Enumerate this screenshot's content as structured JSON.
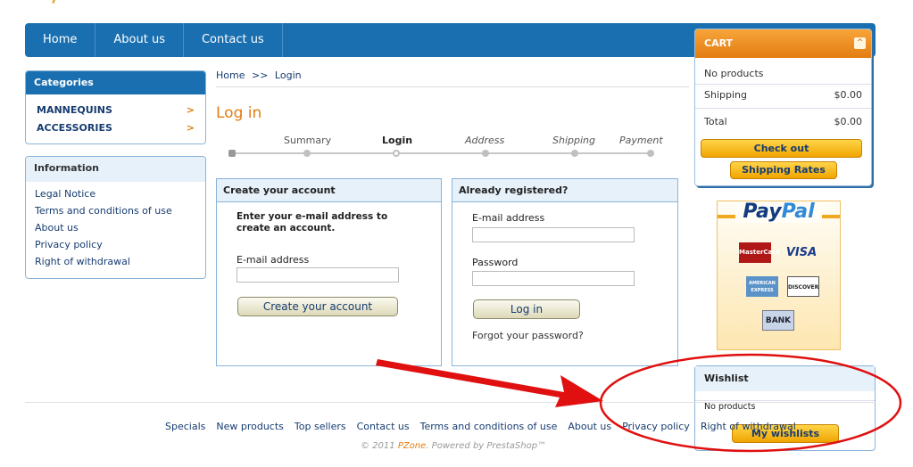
{
  "top_nav": {
    "items": [
      "Home",
      "About us",
      "Contact us"
    ]
  },
  "cart": {
    "title": "CART",
    "toggle_icon": "^",
    "status": "No products",
    "shipping_label": "Shipping",
    "shipping_value": "$0.00",
    "total_label": "Total",
    "total_value": "$0.00",
    "checkout_label": "Check out",
    "shipping_rates_label": "Shipping Rates"
  },
  "categories": {
    "title": "Categories",
    "items": [
      "MANNEQUINS",
      "ACCESSORIES"
    ],
    "chevron": ">"
  },
  "information": {
    "title": "Information",
    "links": [
      "Legal Notice",
      "Terms and conditions of use",
      "About us",
      "Privacy policy",
      "Right of withdrawal"
    ]
  },
  "breadcrumb": {
    "home": "Home",
    "sep": ">>",
    "current": "Login"
  },
  "page_title": "Log in",
  "steps": [
    "Summary",
    "Login",
    "Address",
    "Shipping",
    "Payment"
  ],
  "create_account": {
    "title": "Create your account",
    "instructions": "Enter your e-mail address to create an account.",
    "email_label": "E-mail address",
    "email_value": "",
    "button": "Create your account"
  },
  "registered": {
    "title": "Already registered?",
    "email_label": "E-mail address",
    "email_value": "",
    "password_label": "Password",
    "password_value": "",
    "button": "Log in",
    "forgot": "Forgot your password?"
  },
  "paypal": {
    "brand_pay": "Pay",
    "brand_pal": "Pal",
    "cards": [
      "MasterCard",
      "VISA",
      "AMERICAN EXPRESS",
      "DISCOVER",
      "BANK"
    ]
  },
  "wishlist": {
    "title": "Wishlist",
    "status": "No products",
    "button": "My wishlists"
  },
  "footer": {
    "links": [
      "Specials",
      "New products",
      "Top sellers",
      "Contact us",
      "Terms and conditions of use",
      "About us",
      "Privacy policy",
      "Right of withdrawal"
    ],
    "copyright_prefix": "© 2011 ",
    "copyright_brand": "PZone",
    "copyright_suffix": ". Powered by PrestaShop™"
  },
  "colors": {
    "nav_blue": "#1a6fb0",
    "accent_orange": "#e37d12",
    "annotation_red": "#e01010"
  },
  "icons": {
    "chevron": "chevron-right-icon",
    "collapse": "collapse-icon"
  }
}
